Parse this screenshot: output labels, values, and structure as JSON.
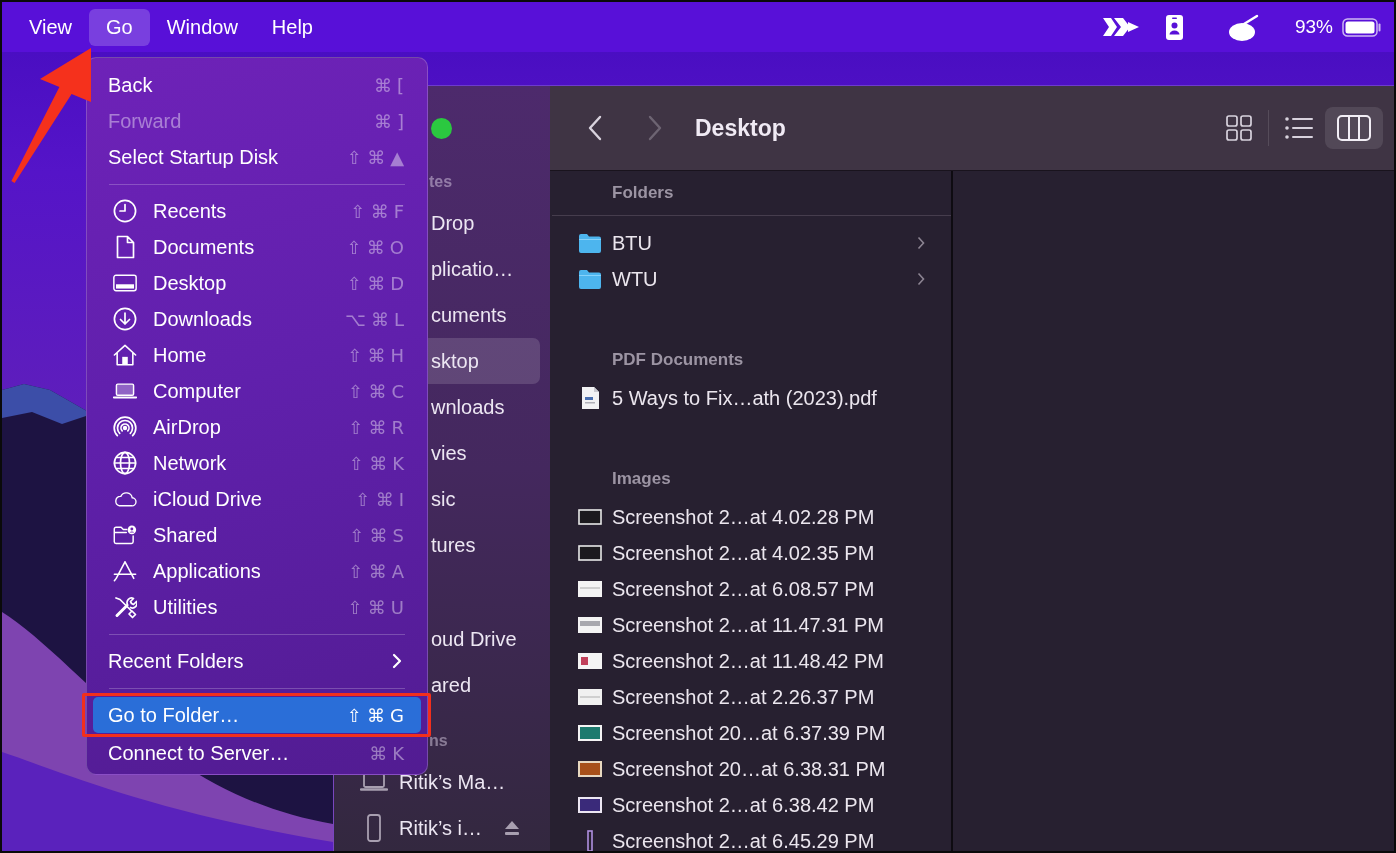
{
  "menu_bar": {
    "items": [
      {
        "label": "View",
        "selected": false
      },
      {
        "label": "Go",
        "selected": true
      },
      {
        "label": "Window",
        "selected": false
      },
      {
        "label": "Help",
        "selected": false
      }
    ],
    "battery": "93%"
  },
  "go_menu": {
    "sections": [
      {
        "items": [
          {
            "kind": "command",
            "label": "Back",
            "shortcut": "⌘[",
            "disabled": false,
            "selected": false
          },
          {
            "kind": "command",
            "label": "Forward",
            "shortcut": "⌘]",
            "disabled": true,
            "selected": false
          },
          {
            "kind": "command",
            "label": "Select Startup Disk",
            "shortcut": "⇧⌘▲",
            "disabled": false,
            "selected": false
          }
        ]
      },
      {
        "items": [
          {
            "kind": "place",
            "label": "Recents",
            "shortcut": "⇧⌘F",
            "disabled": false,
            "selected": false
          },
          {
            "kind": "place",
            "label": "Documents",
            "shortcut": "⇧⌘O",
            "disabled": false,
            "selected": false
          },
          {
            "kind": "place",
            "label": "Desktop",
            "shortcut": "⇧⌘D",
            "disabled": false,
            "selected": false
          },
          {
            "kind": "place",
            "label": "Downloads",
            "shortcut": "⌥⌘L",
            "disabled": false,
            "selected": false
          },
          {
            "kind": "place",
            "label": "Home",
            "shortcut": "⇧⌘H",
            "disabled": false,
            "selected": false
          },
          {
            "kind": "place",
            "label": "Computer",
            "shortcut": "⇧⌘C",
            "disabled": false,
            "selected": false
          },
          {
            "kind": "place",
            "label": "AirDrop",
            "shortcut": "⇧⌘R",
            "disabled": false,
            "selected": false
          },
          {
            "kind": "place",
            "label": "Network",
            "shortcut": "⇧⌘K",
            "disabled": false,
            "selected": false
          },
          {
            "kind": "place",
            "label": "iCloud Drive",
            "shortcut": "⇧⌘I",
            "disabled": false,
            "selected": false
          },
          {
            "kind": "place",
            "label": "Shared",
            "shortcut": "⇧⌘S",
            "disabled": false,
            "selected": false
          },
          {
            "kind": "place",
            "label": "Applications",
            "shortcut": "⇧⌘A",
            "disabled": false,
            "selected": false
          },
          {
            "kind": "place",
            "label": "Utilities",
            "shortcut": "⇧⌘U",
            "disabled": false,
            "selected": false
          }
        ]
      },
      {
        "items": [
          {
            "kind": "submenu",
            "label": "Recent Folders",
            "disabled": false,
            "selected": false
          }
        ]
      },
      {
        "items": [
          {
            "kind": "command",
            "label": "Go to Folder…",
            "shortcut": "⇧⌘G",
            "disabled": false,
            "selected": true
          },
          {
            "kind": "command",
            "label": "Connect to Server…",
            "shortcut": "⌘K",
            "disabled": false,
            "selected": false
          }
        ]
      }
    ]
  },
  "finder": {
    "sidebar": {
      "sections": [
        {
          "heading": "tes",
          "items": [
            {
              "kind": "place",
              "label": "Drop",
              "selected": false
            },
            {
              "kind": "place",
              "label": "plicatio…",
              "selected": false
            },
            {
              "kind": "place",
              "label": "cuments",
              "selected": false
            },
            {
              "kind": "place",
              "label": "sktop",
              "selected": true
            },
            {
              "kind": "place",
              "label": "wnloads",
              "selected": false
            },
            {
              "kind": "place",
              "label": "vies",
              "selected": false
            },
            {
              "kind": "place",
              "label": "sic",
              "selected": false
            },
            {
              "kind": "place",
              "label": "tures",
              "selected": false
            }
          ]
        },
        {
          "items": [
            {
              "kind": "place",
              "label": "oud Drive",
              "selected": false
            },
            {
              "kind": "place",
              "label": "ared",
              "selected": false
            }
          ]
        },
        {
          "heading": "ns",
          "items": [
            {
              "kind": "computer",
              "label": "Ritik’s Ma…",
              "selected": false
            },
            {
              "kind": "phone",
              "label": "Ritik’s i…",
              "selected": false
            }
          ]
        }
      ]
    },
    "toolbar": {
      "back": {
        "disabled": false
      },
      "forward": {
        "disabled": true
      },
      "title": "Desktop",
      "views": [
        {
          "selected": false
        },
        {
          "selected": false
        },
        {
          "selected": true
        }
      ]
    },
    "column": {
      "groups": [
        {
          "heading": "Folders",
          "items": [
            {
              "kind": "folder",
              "label": "BTU"
            },
            {
              "kind": "folder",
              "label": "WTU"
            }
          ]
        },
        {
          "heading": "PDF Documents",
          "items": [
            {
              "kind": "pdf",
              "label": "5 Ways to Fix…ath (2023).pdf"
            }
          ]
        },
        {
          "heading": "Images",
          "items": [
            {
              "kind": "image",
              "label": "Screenshot 2…at 4.02.28 PM"
            },
            {
              "kind": "image",
              "label": "Screenshot 2…at 4.02.35 PM"
            },
            {
              "kind": "image",
              "label": "Screenshot 2…at 6.08.57 PM"
            },
            {
              "kind": "image",
              "label": "Screenshot 2…at 11.47.31 PM"
            },
            {
              "kind": "image",
              "label": "Screenshot 2…at 11.48.42 PM"
            },
            {
              "kind": "image",
              "label": "Screenshot 2…at 2.26.37 PM"
            },
            {
              "kind": "image",
              "label": "Screenshot 20…at 6.37.39 PM"
            },
            {
              "kind": "image",
              "label": "Screenshot 20…at 6.38.31 PM"
            },
            {
              "kind": "image",
              "label": "Screenshot 2…at 6.38.42 PM"
            },
            {
              "kind": "image",
              "label": "Screenshot 2…at 6.45.29 PM"
            }
          ]
        }
      ]
    }
  }
}
